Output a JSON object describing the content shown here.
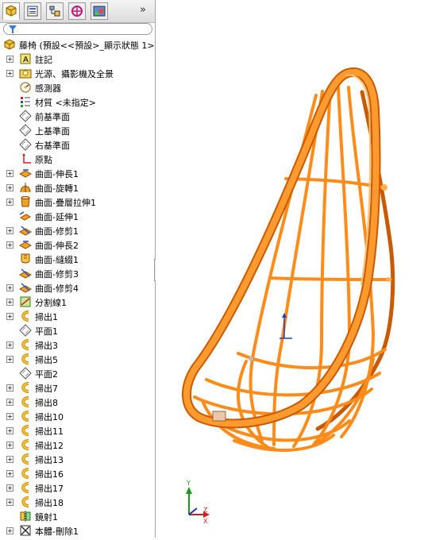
{
  "tabs": [
    "feature-manager",
    "property-manager",
    "configuration-manager",
    "dimxpert-manager",
    "display-manager"
  ],
  "more_label": "»",
  "tree": {
    "root": "藤椅 (預設<<預設>_顯示狀態 1>)",
    "items": [
      {
        "label": "註記",
        "expandable": true,
        "icon": "annotation-icon"
      },
      {
        "label": "光源、攝影機及全景",
        "expandable": true,
        "icon": "lights-icon"
      },
      {
        "label": "感測器",
        "expandable": false,
        "icon": "sensor-icon"
      },
      {
        "label": "材質 <未指定>",
        "expandable": false,
        "icon": "material-icon"
      },
      {
        "label": "前基準面",
        "expandable": false,
        "icon": "plane-icon"
      },
      {
        "label": "上基準面",
        "expandable": false,
        "icon": "plane-icon"
      },
      {
        "label": "右基準面",
        "expandable": false,
        "icon": "plane-icon"
      },
      {
        "label": "原點",
        "expandable": false,
        "icon": "origin-icon"
      },
      {
        "label": "曲面-伸長1",
        "expandable": true,
        "icon": "surface-extrude-icon"
      },
      {
        "label": "曲面-旋轉1",
        "expandable": true,
        "icon": "surface-revolve-icon"
      },
      {
        "label": "曲面-疊層拉伸1",
        "expandable": true,
        "icon": "surface-loft-icon"
      },
      {
        "label": "曲面-延伸1",
        "expandable": false,
        "icon": "surface-extend-icon"
      },
      {
        "label": "曲面-修剪1",
        "expandable": true,
        "icon": "surface-trim-icon"
      },
      {
        "label": "曲面-伸長2",
        "expandable": true,
        "icon": "surface-extrude-icon"
      },
      {
        "label": "曲面-縫綴1",
        "expandable": false,
        "icon": "surface-knit-icon"
      },
      {
        "label": "曲面-修剪3",
        "expandable": false,
        "icon": "surface-trim-icon"
      },
      {
        "label": "曲面-修剪4",
        "expandable": true,
        "icon": "surface-trim-icon"
      },
      {
        "label": "分割線1",
        "expandable": true,
        "icon": "split-line-icon"
      },
      {
        "label": "掃出1",
        "expandable": true,
        "icon": "sweep-icon"
      },
      {
        "label": "平面1",
        "expandable": false,
        "icon": "plane-icon"
      },
      {
        "label": "掃出3",
        "expandable": true,
        "icon": "sweep-icon"
      },
      {
        "label": "掃出5",
        "expandable": true,
        "icon": "sweep-icon"
      },
      {
        "label": "平面2",
        "expandable": false,
        "icon": "plane-icon"
      },
      {
        "label": "掃出7",
        "expandable": true,
        "icon": "sweep-icon"
      },
      {
        "label": "掃出8",
        "expandable": true,
        "icon": "sweep-icon"
      },
      {
        "label": "掃出10",
        "expandable": true,
        "icon": "sweep-icon"
      },
      {
        "label": "掃出11",
        "expandable": true,
        "icon": "sweep-icon"
      },
      {
        "label": "掃出12",
        "expandable": true,
        "icon": "sweep-icon"
      },
      {
        "label": "掃出13",
        "expandable": true,
        "icon": "sweep-icon"
      },
      {
        "label": "掃出16",
        "expandable": true,
        "icon": "sweep-icon"
      },
      {
        "label": "掃出17",
        "expandable": true,
        "icon": "sweep-icon"
      },
      {
        "label": "掃出18",
        "expandable": true,
        "icon": "sweep-icon"
      },
      {
        "label": "鏡射1",
        "expandable": false,
        "icon": "mirror-icon"
      },
      {
        "label": "本體-刪除1",
        "expandable": true,
        "icon": "delete-body-icon"
      }
    ]
  },
  "triad": {
    "x": "X",
    "y": "Y",
    "z": "Z"
  },
  "colors": {
    "chair": "#ff8c1a",
    "chair_dark": "#c85a00",
    "chair_light": "#ffc070"
  }
}
